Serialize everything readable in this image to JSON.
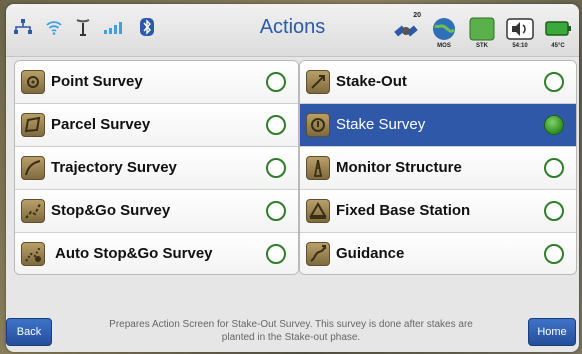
{
  "header": {
    "title": "Actions",
    "status_icons_left": [
      "network-icon",
      "wifi-icon",
      "antenna-icon",
      "signal-bars-icon",
      "bluetooth-icon"
    ],
    "status_icons_right": [
      {
        "icon": "satellite-icon",
        "label": "20"
      },
      {
        "icon": "globe-icon",
        "label": "MOS"
      },
      {
        "icon": "survey-mode-icon",
        "label": "STK"
      },
      {
        "icon": "volume-icon",
        "label": "54:10"
      },
      {
        "icon": "battery-icon",
        "label": "45°C"
      }
    ]
  },
  "left_actions": [
    {
      "label": "Point Survey",
      "icon": "point-survey-icon",
      "selected": false
    },
    {
      "label": "Parcel Survey",
      "icon": "parcel-survey-icon",
      "selected": false
    },
    {
      "label": "Trajectory Survey",
      "icon": "trajectory-survey-icon",
      "selected": false
    },
    {
      "label": "Stop&Go Survey",
      "icon": "stop-go-survey-icon",
      "selected": false
    },
    {
      "label": "Auto Stop&Go Survey",
      "icon": "auto-stop-go-survey-icon",
      "selected": false
    }
  ],
  "right_actions": [
    {
      "label": "Stake-Out",
      "icon": "stake-out-icon",
      "selected": false
    },
    {
      "label": "Stake Survey",
      "icon": "stake-survey-icon",
      "selected": true
    },
    {
      "label": "Monitor Structure",
      "icon": "monitor-structure-icon",
      "selected": false
    },
    {
      "label": "Fixed Base Station",
      "icon": "fixed-base-station-icon",
      "selected": false
    },
    {
      "label": "Guidance",
      "icon": "guidance-icon",
      "selected": false
    }
  ],
  "footer": {
    "description": "Prepares Action Screen for Stake-Out Survey. This survey is done after stakes are planted in the Stake-out phase.",
    "back_label": "Back",
    "home_label": "Home"
  },
  "colors": {
    "title": "#2a5aa8",
    "selected_row": "#2f58a8",
    "radio": "#2f7d2a",
    "button": "#2f5fb0"
  }
}
